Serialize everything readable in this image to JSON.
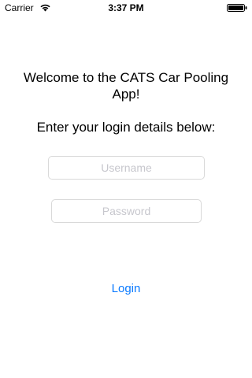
{
  "status_bar": {
    "carrier": "Carrier",
    "time": "3:37 PM",
    "icons": [
      "wifi-icon",
      "battery-icon"
    ]
  },
  "login": {
    "welcome_text": "Welcome to the CATS Car Pooling App!",
    "instructions": "Enter your login details below:",
    "username_placeholder": "Username",
    "password_placeholder": "Password",
    "login_label": "Login"
  },
  "colors": {
    "accent": "#0a7aff",
    "field_border": "#d9d9d9",
    "placeholder": "#c7c7cd",
    "background": "#ffffff"
  }
}
